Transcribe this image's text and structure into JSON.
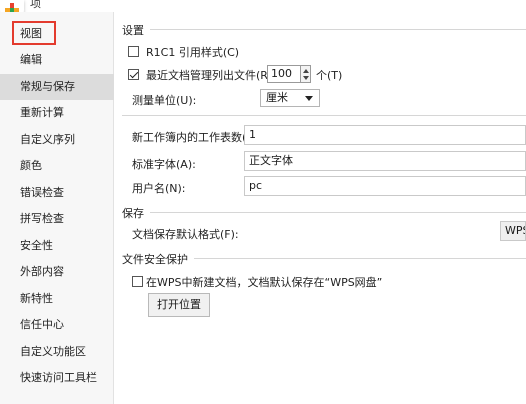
{
  "window": {
    "title": "项"
  },
  "sidebar": {
    "items": [
      {
        "label": "视图"
      },
      {
        "label": "编辑"
      },
      {
        "label": "常规与保存"
      },
      {
        "label": "重新计算"
      },
      {
        "label": "自定义序列"
      },
      {
        "label": "颜色"
      },
      {
        "label": "错误检查"
      },
      {
        "label": "拼写检查"
      },
      {
        "label": "安全性"
      },
      {
        "label": "外部内容"
      },
      {
        "label": "新特性"
      },
      {
        "label": "信任中心"
      },
      {
        "label": "自定义功能区"
      },
      {
        "label": "快速访问工具栏"
      }
    ],
    "selected": "常规与保存"
  },
  "settings": {
    "title": "设置",
    "r1c1_label": "R1C1 引用样式(C)",
    "r1c1_checked": false,
    "recent_label": "最近文档管理列出文件(R):",
    "recent_checked": true,
    "recent_value": "100",
    "recent_unit": "个(T)",
    "unit_label": "测量单位(U):",
    "unit_value": "厘米",
    "sheets_label": "新工作簿内的工作表数(S):",
    "sheets_value": "1",
    "font_label": "标准字体(A):",
    "font_value": "正文字体",
    "user_label": "用户名(N):",
    "user_value": "pc"
  },
  "save": {
    "title": "保存",
    "format_label": "文档保存默认格式(F):",
    "format_value": "WPS"
  },
  "file_security": {
    "title": "文件安全保护",
    "cloud_label": "在WPS中新建文档，文档默认保存在“WPS网盘”",
    "cloud_checked": false,
    "open_location_label": "打开位置"
  },
  "colors": {
    "highlight": "#e33b2e",
    "selected_bg": "#dcdcdc"
  }
}
